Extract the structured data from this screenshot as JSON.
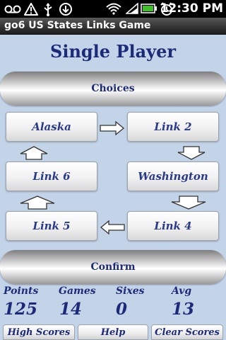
{
  "status_bar": {
    "time": "12:30 PM",
    "icons": [
      "voicemail-icon",
      "warning-icon",
      "usb-icon",
      "download-icon",
      "wifi-icon",
      "battery-icon",
      "alarm-icon"
    ]
  },
  "app": {
    "title": "go6 US States Links Game"
  },
  "screen": {
    "title": "Single Player"
  },
  "buttons": {
    "choices": "Choices",
    "confirm": "Confirm"
  },
  "links": {
    "start": "Alaska",
    "link2": "Link 2",
    "link6": "Link 6",
    "washington": "Washington",
    "link5": "Link 5",
    "link4": "Link 4"
  },
  "stats": {
    "points_label": "Points",
    "points_value": "125",
    "games_label": "Games",
    "games_value": "14",
    "sixes_label": "Sixes",
    "sixes_value": "0",
    "avg_label": "Avg",
    "avg_value": "13"
  },
  "bottom": {
    "high_scores": "High Scores",
    "help": "Help",
    "clear_scores": "Clear Scores"
  },
  "colors": {
    "background": "#c4d4e8",
    "text_accent": "#1d2a7a"
  }
}
